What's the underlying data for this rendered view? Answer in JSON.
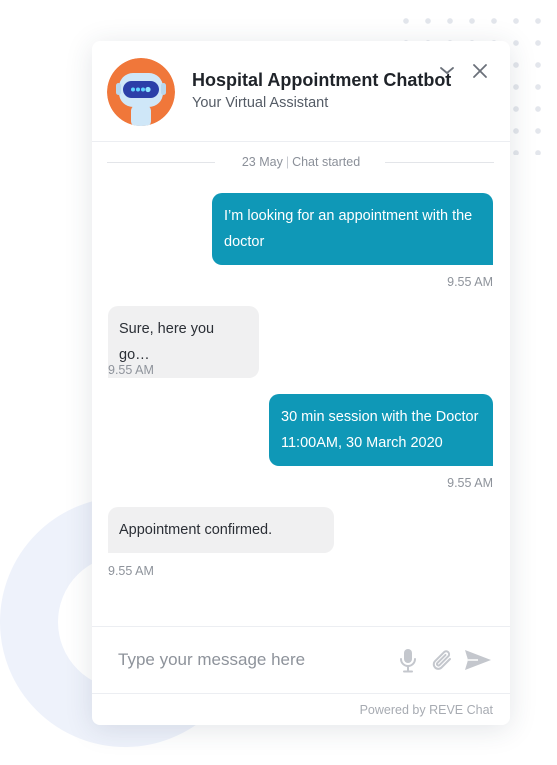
{
  "header": {
    "title": "Hospital Appointment Chatbot",
    "subtitle": "Your Virtual Assistant"
  },
  "divider": {
    "date": "23 May",
    "separator": "|",
    "status": "Chat started"
  },
  "messages": [
    {
      "sender": "user",
      "text": "I’m looking for an appointment with the doctor",
      "time": "9.55 AM"
    },
    {
      "sender": "bot",
      "text": "Sure, here you go…",
      "time": "9.55 AM"
    },
    {
      "sender": "user",
      "text_line1": "30 min session with the Doctor",
      "text_line2": "11:00AM, 30 March 2020",
      "time": "9.55 AM"
    },
    {
      "sender": "bot",
      "text": "Appointment confirmed.",
      "time": "9.55 AM"
    }
  ],
  "composer": {
    "placeholder": "Type your message here",
    "value": ""
  },
  "footer": {
    "powered_by": "Powered by REVE Chat"
  },
  "icons": {
    "minimize": "chevron-down-icon",
    "close": "close-icon",
    "mic": "microphone-icon",
    "attach": "paperclip-icon",
    "send": "send-icon"
  },
  "colors": {
    "accent": "#0f98b7",
    "bot_bubble": "#f0f0f1",
    "avatar_bg": "#f0773a",
    "robot_body": "#cfe7f8",
    "robot_visor": "#2c3fa8",
    "icon_gray": "#c4c7cd"
  }
}
